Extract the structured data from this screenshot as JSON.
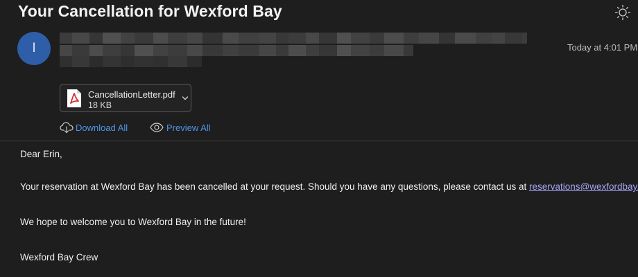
{
  "message": {
    "subject": "Your Cancellation for Wexford Bay",
    "sender_initial": "I",
    "timestamp": "Today at 4:01 PM"
  },
  "attachment": {
    "file_name": "CancellationLetter.pdf",
    "file_size": "18 KB",
    "icon": "pdf-file-icon"
  },
  "actions": {
    "download_all": "Download All",
    "preview_all": "Preview All"
  },
  "body": {
    "greeting": "Dear Erin,",
    "paragraph1_before": "Your reservation at Wexford Bay has been cancelled at your request. Should you have any questions, please contact us at ",
    "email_link": "reservations@wexfordbay.com",
    "paragraph1_after": ".",
    "paragraph2": "We hope to welcome you to Wexford Bay in the future!",
    "signature": "Wexford Bay Crew"
  },
  "colors": {
    "background": "#1e1e1e",
    "avatar": "#2e5ea8",
    "action_link": "#4f95e8",
    "email_link": "#a6a3f5"
  },
  "icons": {
    "appearance_toggle": "sun-icon",
    "download": "cloud-download-icon",
    "preview": "eye-icon",
    "attachment_menu": "chevron-down-icon"
  }
}
